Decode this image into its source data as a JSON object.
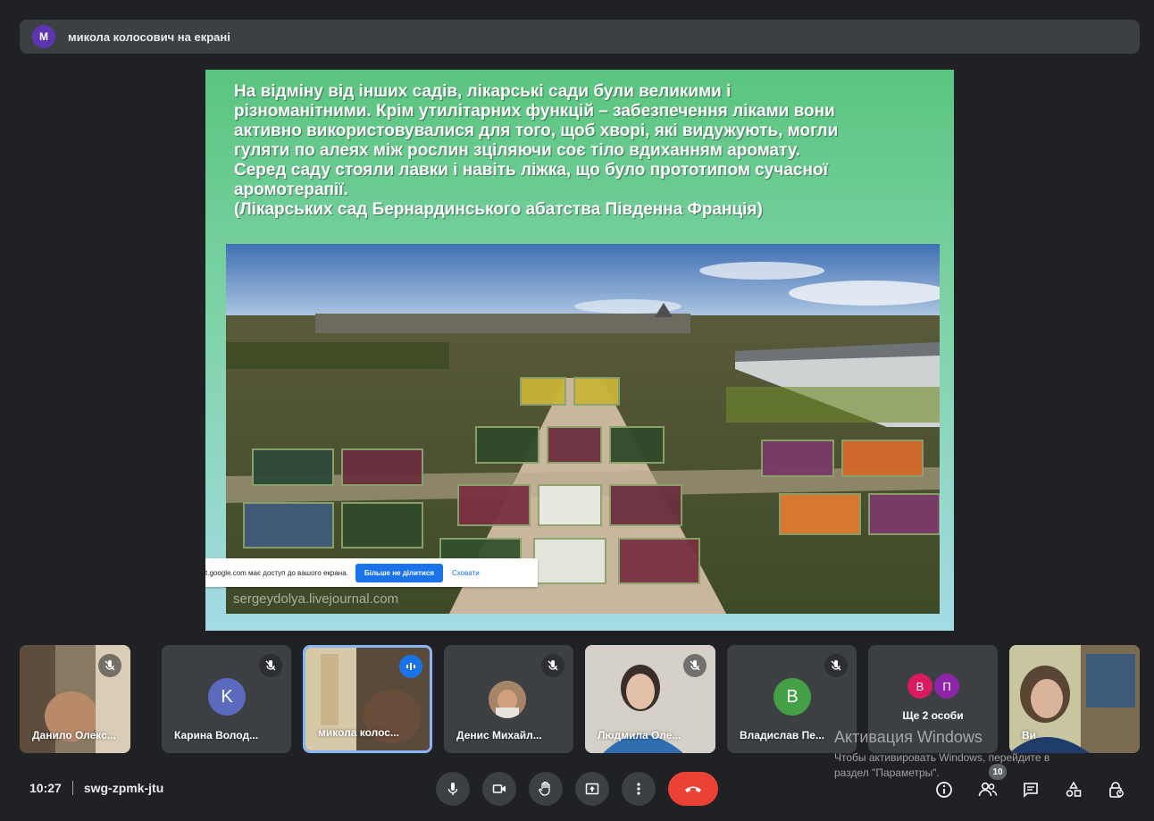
{
  "presenter": {
    "avatar_letter": "М",
    "text": "микола колосович на екрані"
  },
  "slide": {
    "lines": [
      "На відміну від інших садів, лікарські сади були великими і",
      "різноманітними. Крім утилітарних функцій – забезпечення ліками вони",
      "активно використовувалися для того, щоб хворі, які видужують, могли",
      "гуляти по алеях між рослин зціляючи соє тіло вдиханням аромату.",
      "Серед саду стояли лавки і навіть ліжка, що було прототипом сучасної",
      "аромотерапії.",
      "(Лікарських сад Бернардинського абатства Південна Франція)"
    ],
    "watermark": "sergeydolya.livejournal.com"
  },
  "share_notice": {
    "text": "t.google.com має доступ до вашого екрана.",
    "stop_label": "Більше не ділитися",
    "hide_label": "Сховати"
  },
  "participants": [
    {
      "name": "Данило Олекс...",
      "muted": true
    },
    {
      "name": "Карина Волод...",
      "muted": true,
      "avatar_letter": "K",
      "color": "#5c6bc0"
    },
    {
      "name": "микола колос...",
      "speaking": true
    },
    {
      "name": "Денис Михайл...",
      "muted": true
    },
    {
      "name": "Людмила Оле...",
      "muted": true
    },
    {
      "name": "Владислав Пе...",
      "muted": true,
      "avatar_letter": "B",
      "color": "#43a047"
    },
    {
      "name": "Ще 2 особи",
      "avatar_letters": [
        "В",
        "П"
      ],
      "colors": [
        "#d81b60",
        "#8e24aa"
      ]
    },
    {
      "name": "Ви"
    }
  ],
  "windows_activation": {
    "title": "Активация Windows",
    "line1": "Чтобы активировать Windows, перейдите в",
    "line2": "раздел \"Параметры\"."
  },
  "meeting": {
    "time": "10:27",
    "code": "swg-zpmk-jtu",
    "participant_count": "10"
  },
  "colors": {
    "background": "#202124",
    "surface": "#3c4043",
    "hangup": "#ea4335",
    "accent": "#8ab4f8"
  }
}
